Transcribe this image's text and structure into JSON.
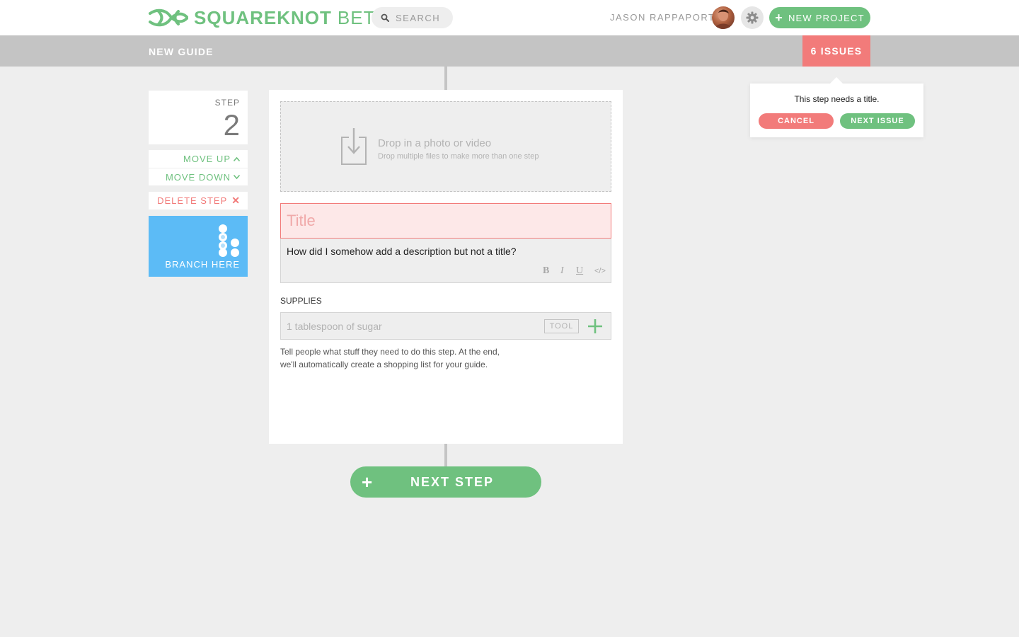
{
  "header": {
    "brand": "SQUAREKNOT",
    "brand_suffix": "BETA",
    "search_placeholder": "SEARCH",
    "user_name": "JASON RAPPAPORT",
    "new_project_label": "NEW PROJECT"
  },
  "subbar": {
    "guide_title": "NEW GUIDE",
    "issues_label": "6 ISSUES"
  },
  "step_controls": {
    "step_label": "STEP",
    "step_number": "2",
    "move_up_label": "MOVE UP",
    "move_down_label": "MOVE DOWN",
    "delete_label": "DELETE STEP",
    "branch_label": "BRANCH HERE"
  },
  "step_card": {
    "drop_title": "Drop in a photo or video",
    "drop_subtitle": "Drop multiple files to make more than one step",
    "title_placeholder": "Title",
    "description": "How did I somehow add a description but not a title?",
    "format_buttons": [
      "B",
      "I",
      "U",
      "</>"
    ],
    "supplies_label": "SUPPLIES",
    "supply_placeholder": "1 tablespoon of sugar",
    "tool_tag": "TOOL",
    "hint_line1": "Tell people what stuff they need to do this step. At the end,",
    "hint_line2": "we'll automatically create a shopping list for your guide."
  },
  "next_step_label": "NEXT STEP",
  "popover": {
    "message": "This step needs a title.",
    "cancel_label": "CANCEL",
    "next_issue_label": "NEXT ISSUE"
  },
  "colors": {
    "brand_green": "#6fc17f",
    "alert_red": "#f27b7a",
    "branch_blue": "#5cbbf6",
    "bar_gray": "#c4c4c4"
  }
}
